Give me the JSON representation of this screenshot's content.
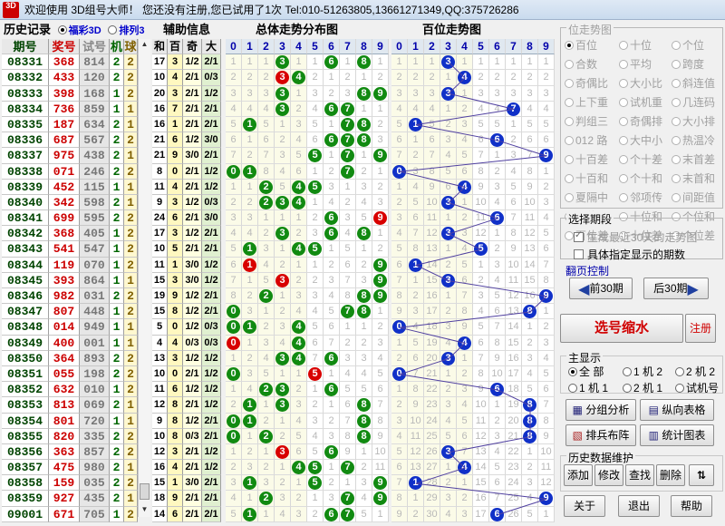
{
  "window": {
    "title": "欢迎使用 3D组号大师！  您还没有注册,您已试用了1次   Tel:010-51263805,13661271349,QQ:375726286",
    "logo_text": "3D"
  },
  "history": {
    "label": "历史记录",
    "options": [
      "福彩3D",
      "排列3"
    ],
    "selected": "福彩3D",
    "columns": [
      "期号",
      "奖号",
      "试号",
      "机",
      "球"
    ],
    "rows": [
      [
        "08331",
        "368",
        "814",
        "2",
        "2"
      ],
      [
        "08332",
        "433",
        "120",
        "2",
        "2"
      ],
      [
        "08333",
        "398",
        "168",
        "1",
        "2"
      ],
      [
        "08334",
        "736",
        "859",
        "1",
        "1"
      ],
      [
        "08335",
        "187",
        "634",
        "2",
        "1"
      ],
      [
        "08336",
        "687",
        "567",
        "2",
        "2"
      ],
      [
        "08337",
        "975",
        "438",
        "2",
        "1"
      ],
      [
        "08338",
        "071",
        "246",
        "2",
        "2"
      ],
      [
        "08339",
        "452",
        "115",
        "1",
        "1"
      ],
      [
        "08340",
        "342",
        "598",
        "2",
        "1"
      ],
      [
        "08341",
        "699",
        "595",
        "2",
        "2"
      ],
      [
        "08342",
        "368",
        "405",
        "1",
        "2"
      ],
      [
        "08343",
        "541",
        "547",
        "1",
        "2"
      ],
      [
        "08344",
        "119",
        "070",
        "1",
        "2"
      ],
      [
        "08345",
        "393",
        "864",
        "1",
        "1"
      ],
      [
        "08346",
        "982",
        "031",
        "2",
        "2"
      ],
      [
        "08347",
        "807",
        "448",
        "1",
        "2"
      ],
      [
        "08348",
        "014",
        "949",
        "1",
        "1"
      ],
      [
        "08349",
        "400",
        "001",
        "1",
        "1"
      ],
      [
        "08350",
        "364",
        "893",
        "2",
        "2"
      ],
      [
        "08351",
        "055",
        "198",
        "2",
        "2"
      ],
      [
        "08352",
        "632",
        "010",
        "1",
        "2"
      ],
      [
        "08353",
        "813",
        "069",
        "2",
        "1"
      ],
      [
        "08354",
        "801",
        "720",
        "1",
        "1"
      ],
      [
        "08355",
        "820",
        "335",
        "2",
        "2"
      ],
      [
        "08356",
        "363",
        "857",
        "2",
        "2"
      ],
      [
        "08357",
        "475",
        "980",
        "2",
        "1"
      ],
      [
        "08358",
        "159",
        "035",
        "2",
        "2"
      ],
      [
        "08359",
        "927",
        "435",
        "2",
        "1"
      ],
      [
        "09001",
        "671",
        "705",
        "1",
        "2"
      ]
    ]
  },
  "aux": {
    "label": "辅助信息",
    "columns": [
      "和",
      "百",
      "奇",
      "大"
    ],
    "rows": [
      [
        "17",
        "3",
        "1/2",
        "2/1"
      ],
      [
        "10",
        "4",
        "2/1",
        "0/3"
      ],
      [
        "20",
        "3",
        "2/1",
        "1/2"
      ],
      [
        "16",
        "7",
        "2/1",
        "2/1"
      ],
      [
        "16",
        "1",
        "2/1",
        "2/1"
      ],
      [
        "21",
        "6",
        "1/2",
        "3/0"
      ],
      [
        "21",
        "9",
        "3/0",
        "2/1"
      ],
      [
        "8",
        "0",
        "2/1",
        "1/2"
      ],
      [
        "11",
        "4",
        "2/1",
        "1/2"
      ],
      [
        "9",
        "3",
        "1/2",
        "0/3"
      ],
      [
        "24",
        "6",
        "2/1",
        "3/0"
      ],
      [
        "17",
        "3",
        "1/2",
        "2/1"
      ],
      [
        "10",
        "5",
        "2/1",
        "2/1"
      ],
      [
        "11",
        "1",
        "3/0",
        "1/2"
      ],
      [
        "15",
        "3",
        "3/0",
        "1/2"
      ],
      [
        "19",
        "9",
        "1/2",
        "2/1"
      ],
      [
        "15",
        "8",
        "1/2",
        "2/1"
      ],
      [
        "5",
        "0",
        "1/2",
        "0/3"
      ],
      [
        "4",
        "4",
        "0/3",
        "0/3"
      ],
      [
        "13",
        "3",
        "1/2",
        "1/2"
      ],
      [
        "10",
        "0",
        "2/1",
        "1/2"
      ],
      [
        "11",
        "6",
        "1/2",
        "1/2"
      ],
      [
        "12",
        "8",
        "2/1",
        "1/2"
      ],
      [
        "9",
        "8",
        "1/2",
        "2/1"
      ],
      [
        "10",
        "8",
        "0/3",
        "2/1"
      ],
      [
        "12",
        "3",
        "2/1",
        "1/2"
      ],
      [
        "16",
        "4",
        "2/1",
        "1/2"
      ],
      [
        "15",
        "1",
        "3/0",
        "2/1"
      ],
      [
        "18",
        "9",
        "2/1",
        "2/1"
      ],
      [
        "14",
        "6",
        "2/1",
        "2/1"
      ]
    ]
  },
  "chart_total": {
    "label": "总体走势分布图",
    "digits": [
      "0",
      "1",
      "2",
      "3",
      "4",
      "5",
      "6",
      "7",
      "8",
      "9"
    ]
  },
  "chart_hundreds": {
    "label": "百位走势图",
    "digits": [
      "0",
      "1",
      "2",
      "3",
      "4",
      "5",
      "6",
      "7",
      "8",
      "9"
    ]
  },
  "colors": {
    "ball_green": "#118a11",
    "ball_red": "#d80000",
    "ball_blue": "#1030c8",
    "line": "#5040a0"
  },
  "position_group": {
    "label": "位走势图",
    "options": [
      "百位",
      "十位",
      "个位",
      "合数",
      "平均",
      "跨度",
      "奇偶比",
      "大小比",
      "斜连值",
      "上下重",
      "试机重",
      "几连码",
      "判组三",
      "奇偶排",
      "大小排",
      "012 路",
      "大中小",
      "热温冷",
      "十百差",
      "个十差",
      "末首差",
      "十百和",
      "个十和",
      "末首和",
      "夏隔中",
      "邻项传",
      "间距值",
      "百位和",
      "十位和",
      "个位和",
      "百位差",
      "十位差",
      "个位差"
    ],
    "selected": "百位"
  },
  "period_group": {
    "label": "选择期段",
    "checkbox_recent": "生成最近30天的走势图",
    "checkbox_specify": "具体指定显示的期数"
  },
  "paging": {
    "label": "翻页控制",
    "prev": "前30期",
    "next": "后30期"
  },
  "select_button": "选号缩水",
  "register_button": "注册",
  "main_display": {
    "label": "主显示",
    "options": [
      "全 部",
      "1 机 2",
      "2 机 2",
      "1 机 1",
      "2 机 1",
      "试机号"
    ],
    "selected": "全 部"
  },
  "tools": {
    "group": "分组分析",
    "vertical": "纵向表格",
    "arrange": "排兵布阵",
    "stats": "统计图表"
  },
  "maintenance": {
    "label": "历史数据维护",
    "add": "添加",
    "edit": "修改",
    "find": "查找",
    "delete": "删除"
  },
  "bottom": {
    "about": "关于",
    "exit": "退出",
    "help": "帮助"
  }
}
